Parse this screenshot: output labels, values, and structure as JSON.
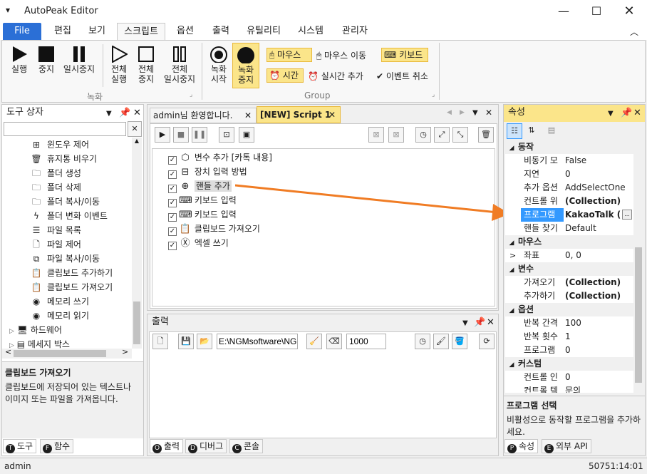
{
  "app": {
    "title": "AutoPeak Editor"
  },
  "menu_tabs": [
    "File",
    "편집",
    "보기",
    "스크립트",
    "옵션",
    "출력",
    "유틸리티",
    "시스템",
    "관리자"
  ],
  "ribbon": {
    "record_group": {
      "label": "녹화",
      "buttons": [
        "실행",
        "중지",
        "일시\n중지",
        "전체\n실행",
        "전체\n중지",
        "전체\n일시중지"
      ]
    },
    "group2": {
      "label": "Group",
      "buttons": [
        "녹화\n시작",
        "녹화\n중지"
      ],
      "small": {
        "mouse": "마우스",
        "mouse_move": "마우스 이동",
        "keyboard": "키보드",
        "time": "시간",
        "realtime_add": "실시간 추가",
        "event_cancel": "이벤트 취소"
      }
    }
  },
  "toolbox": {
    "title": "도구 상자",
    "search_placeholder": "",
    "items": [
      {
        "label": "윈도우 제어",
        "icon": "window-grid-icon"
      },
      {
        "label": "휴지통 비우기",
        "icon": "trash-icon"
      },
      {
        "label": "폴더 생성",
        "icon": "folder-add-icon"
      },
      {
        "label": "폴더 삭제",
        "icon": "folder-delete-icon"
      },
      {
        "label": "폴더 복사/이동",
        "icon": "folder-copy-icon"
      },
      {
        "label": "폴더 변화 이벤트",
        "icon": "lightning-icon"
      },
      {
        "label": "파일 목록",
        "icon": "file-list-icon"
      },
      {
        "label": "파일 제어",
        "icon": "file-icon"
      },
      {
        "label": "파일 복사/이동",
        "icon": "file-copy-icon"
      },
      {
        "label": "클립보드 추가하기",
        "icon": "clipboard-add-icon"
      },
      {
        "label": "클립보드 가져오기",
        "icon": "clipboard-icon"
      },
      {
        "label": "메모리 쓰기",
        "icon": "memory-write-icon"
      },
      {
        "label": "메모리 읽기",
        "icon": "memory-read-icon"
      }
    ],
    "groups": [
      "하드웨어",
      "메세지 박스"
    ],
    "desc_title": "클립보드 가져오기",
    "desc_text": "클립보드에 저장되어 있는 텍스트나 이미지 또는 파일을 가져옵니다.",
    "tabs": [
      "도구",
      "함수"
    ]
  },
  "editor": {
    "tabs": [
      "admin님 환영합니다.",
      "[NEW] Script 1"
    ],
    "rows": [
      {
        "label": "변수 추가 [카톡 내용]",
        "icon": "variable-cube-icon"
      },
      {
        "label": "장치 입력 방법",
        "icon": "device-input-icon"
      },
      {
        "label": "핸들 추가",
        "icon": "crosshair-icon"
      },
      {
        "label": "키보드 입력",
        "icon": "keyboard-icon"
      },
      {
        "label": "키보드 입력",
        "icon": "keyboard-icon"
      },
      {
        "label": "클립보드 가져오기",
        "icon": "clipboard-icon"
      },
      {
        "label": "엑셀 쓰기",
        "icon": "excel-icon"
      }
    ]
  },
  "output": {
    "title": "출력",
    "path": "E:\\NGMsoftware\\NG",
    "count": "1000",
    "tabs": [
      "출력",
      "디버그",
      "콘솔"
    ]
  },
  "properties": {
    "title": "속성",
    "categories": [
      {
        "name": "동작",
        "rows": [
          [
            "비동기 모",
            "False"
          ],
          [
            "지연",
            "0"
          ],
          [
            "추가 옵션",
            "AddSelectOne"
          ],
          [
            "컨트롤 위",
            "(Collection)"
          ],
          [
            "프로그램",
            "KakaoTalk ( 등"
          ],
          [
            "핸들 찾기",
            "Default"
          ]
        ]
      },
      {
        "name": "마우스",
        "rows": [
          [
            "좌표",
            "0, 0"
          ]
        ]
      },
      {
        "name": "변수",
        "rows": [
          [
            "가져오기",
            "(Collection)"
          ],
          [
            "추가하기",
            "(Collection)"
          ]
        ]
      },
      {
        "name": "옵션",
        "rows": [
          [
            "반복 간격",
            "100"
          ],
          [
            "반복 횟수",
            "1"
          ],
          [
            "프로그램",
            "0"
          ]
        ]
      },
      {
        "name": "커스텀",
        "rows": [
          [
            "컨트롤 인",
            "0"
          ],
          [
            "컨트롤 텍",
            "문의"
          ]
        ]
      }
    ],
    "desc_title": "프로그램 선택",
    "desc_text": "비활성으로 동작할 프로그램을 추가하세요.",
    "tabs": [
      "속성",
      "외부 API"
    ]
  },
  "status": {
    "user": "admin",
    "time": "50751:14:01"
  },
  "colors": {
    "accent": "#2b6fd6",
    "highlight": "#fbe58a",
    "arrow": "#f07c24",
    "selected": "#3399ff"
  }
}
